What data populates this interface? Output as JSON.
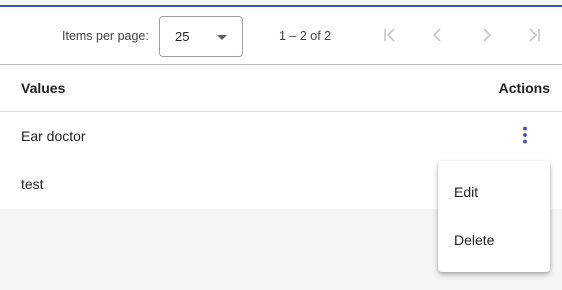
{
  "colors": {
    "accent": "#3f51b5",
    "disabled_icon": "#c7c7c7",
    "kebab": "#3f51b5"
  },
  "paginator": {
    "items_per_page_label": "Items per page:",
    "page_size_value": "25",
    "range_label": "1 – 2 of 2",
    "buttons": [
      {
        "name": "first-page",
        "icon": "first-page-icon",
        "disabled": true
      },
      {
        "name": "previous-page",
        "icon": "chevron-left-icon",
        "disabled": true
      },
      {
        "name": "next-page",
        "icon": "chevron-right-icon",
        "disabled": true
      },
      {
        "name": "last-page",
        "icon": "last-page-icon",
        "disabled": true
      }
    ]
  },
  "table": {
    "headers": {
      "values": "Values",
      "actions": "Actions"
    },
    "rows": [
      {
        "value": "Ear doctor"
      },
      {
        "value": "test"
      }
    ],
    "row_action_icon": "more-vert-icon"
  },
  "menu": {
    "items": [
      {
        "label": "Edit"
      },
      {
        "label": "Delete"
      }
    ]
  }
}
